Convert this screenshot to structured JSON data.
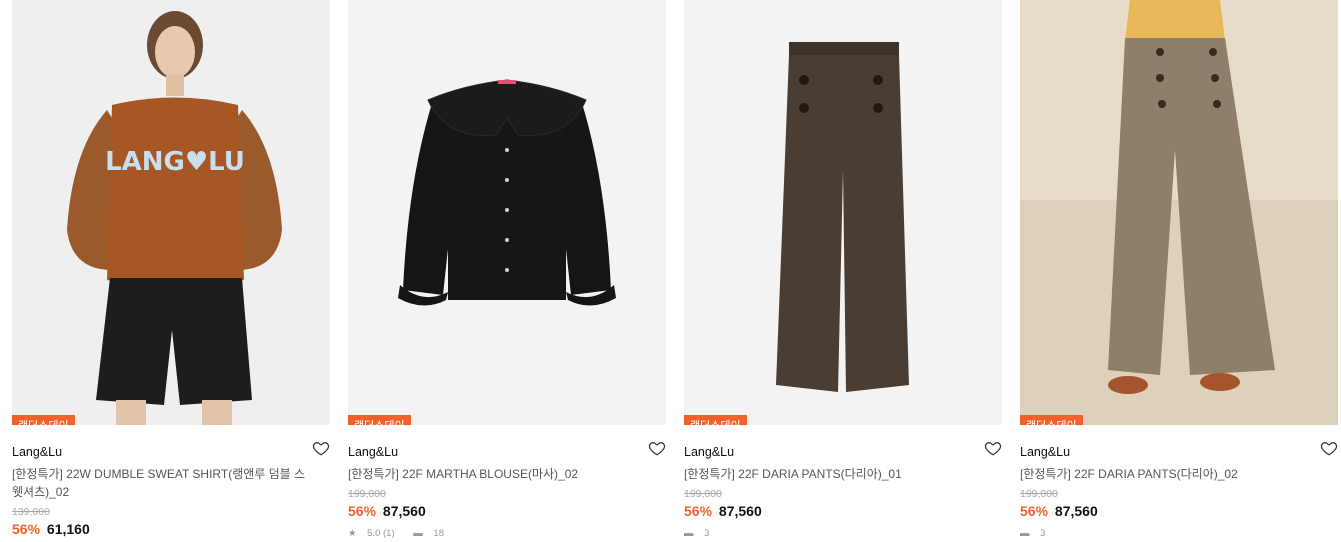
{
  "products": [
    {
      "badge": "랜더스데이",
      "brand": "Lang&Lu",
      "name": "[한정특가] 22W DUMBLE SWEAT SHIRT(랭앤루 덤블 스웻셔츠)_02",
      "original_price": "139,000",
      "discount": "56%",
      "price": "61,160",
      "image_icon": "model-sweatshirt-image"
    },
    {
      "badge": "랜더스데이",
      "brand": "Lang&Lu",
      "name": "[한정특가] 22F MARTHA BLOUSE(마사)_02",
      "original_price": "199,000",
      "discount": "56%",
      "price": "87,560",
      "rating_text": "5.0 (1)",
      "review_count": "18",
      "image_icon": "black-blouse-image"
    },
    {
      "badge": "랜더스데이",
      "brand": "Lang&Lu",
      "name": "[한정특가] 22F DARIA PANTS(다리아)_01",
      "original_price": "199,000",
      "discount": "56%",
      "price": "87,560",
      "review_count": "3",
      "image_icon": "brown-pants-image"
    },
    {
      "badge": "랜더스데이",
      "brand": "Lang&Lu",
      "name": "[한정특가] 22F DARIA PANTS(다리아)_02",
      "original_price": "199,000",
      "discount": "56%",
      "price": "87,560",
      "review_count": "3",
      "image_icon": "model-wide-pants-image"
    }
  ],
  "colors": {
    "accent": "#f3612b",
    "image_bg": "#f4f4f4"
  }
}
